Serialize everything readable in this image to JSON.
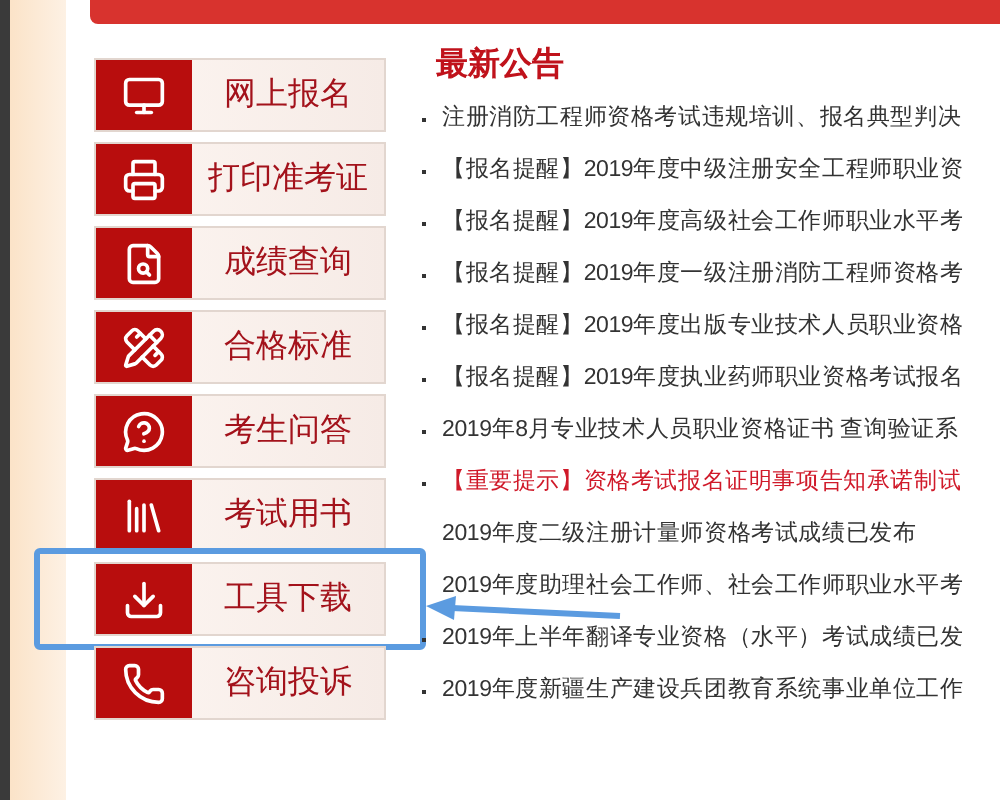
{
  "menu": [
    {
      "label": "网上报名",
      "highlighted": false
    },
    {
      "label": "打印准考证",
      "highlighted": false
    },
    {
      "label": "成绩查询",
      "highlighted": false
    },
    {
      "label": "合格标准",
      "highlighted": false
    },
    {
      "label": "考生问答",
      "highlighted": false
    },
    {
      "label": "考试用书",
      "highlighted": false
    },
    {
      "label": "工具下载",
      "highlighted": true
    },
    {
      "label": "咨询投诉",
      "highlighted": false
    }
  ],
  "news": {
    "title": "最新公告",
    "items": [
      {
        "bullet": true,
        "text": "注册消防工程师资格考试违规培训、报名典型判决"
      },
      {
        "bullet": true,
        "tag": "【报名提醒】",
        "text": "2019年度中级注册安全工程师职业资"
      },
      {
        "bullet": true,
        "tag": "【报名提醒】",
        "text": "2019年度高级社会工作师职业水平考"
      },
      {
        "bullet": true,
        "tag": "【报名提醒】",
        "text": "2019年度一级注册消防工程师资格考"
      },
      {
        "bullet": true,
        "tag": "【报名提醒】",
        "text": "2019年度出版专业技术人员职业资格"
      },
      {
        "bullet": true,
        "tag": "【报名提醒】",
        "text": "2019年度执业药师职业资格考试报名"
      },
      {
        "bullet": true,
        "text": "2019年8月专业技术人员职业资格证书 查询验证系"
      },
      {
        "bullet": true,
        "important": true,
        "tag": "【重要提示】",
        "text": "资格考试报名证明事项告知承诺制试"
      },
      {
        "bullet": false,
        "important": false,
        "text": "2019年度二级注册计量师资格考试成绩已发布"
      },
      {
        "bullet": false,
        "important": false,
        "text": "2019年度助理社会工作师、社会工作师职业水平考"
      },
      {
        "bullet": true,
        "text": "2019年上半年翻译专业资格（水平）考试成绩已发"
      },
      {
        "bullet": true,
        "text": "2019年度新疆生产建设兵团教育系统事业单位工作"
      }
    ]
  }
}
